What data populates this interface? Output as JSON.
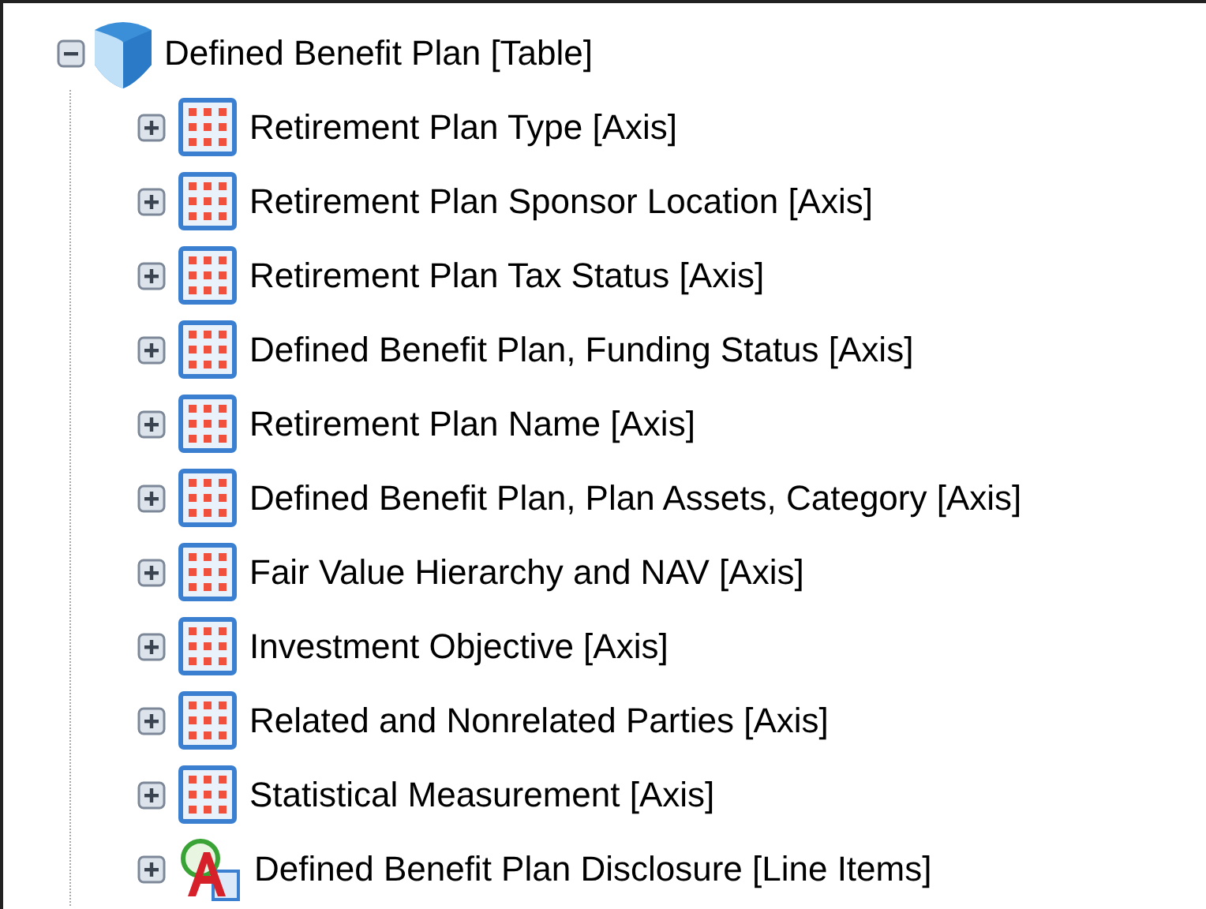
{
  "tree": {
    "label": "Defined Benefit Plan [Table]",
    "kind": "table",
    "expanded": true,
    "children": [
      {
        "label": "Retirement Plan Type [Axis]",
        "kind": "axis",
        "expanded": false
      },
      {
        "label": "Retirement Plan Sponsor Location [Axis]",
        "kind": "axis",
        "expanded": false
      },
      {
        "label": "Retirement Plan Tax Status [Axis]",
        "kind": "axis",
        "expanded": false
      },
      {
        "label": "Defined Benefit Plan, Funding Status [Axis]",
        "kind": "axis",
        "expanded": false
      },
      {
        "label": "Retirement Plan Name [Axis]",
        "kind": "axis",
        "expanded": false
      },
      {
        "label": "Defined Benefit Plan, Plan Assets, Category [Axis]",
        "kind": "axis",
        "expanded": false
      },
      {
        "label": "Fair Value Hierarchy and NAV [Axis]",
        "kind": "axis",
        "expanded": false
      },
      {
        "label": "Investment Objective [Axis]",
        "kind": "axis",
        "expanded": false
      },
      {
        "label": "Related and Nonrelated Parties [Axis]",
        "kind": "axis",
        "expanded": false
      },
      {
        "label": "Statistical Measurement [Axis]",
        "kind": "axis",
        "expanded": false
      },
      {
        "label": "Defined Benefit Plan Disclosure [Line Items]",
        "kind": "line-items",
        "expanded": false
      }
    ]
  }
}
